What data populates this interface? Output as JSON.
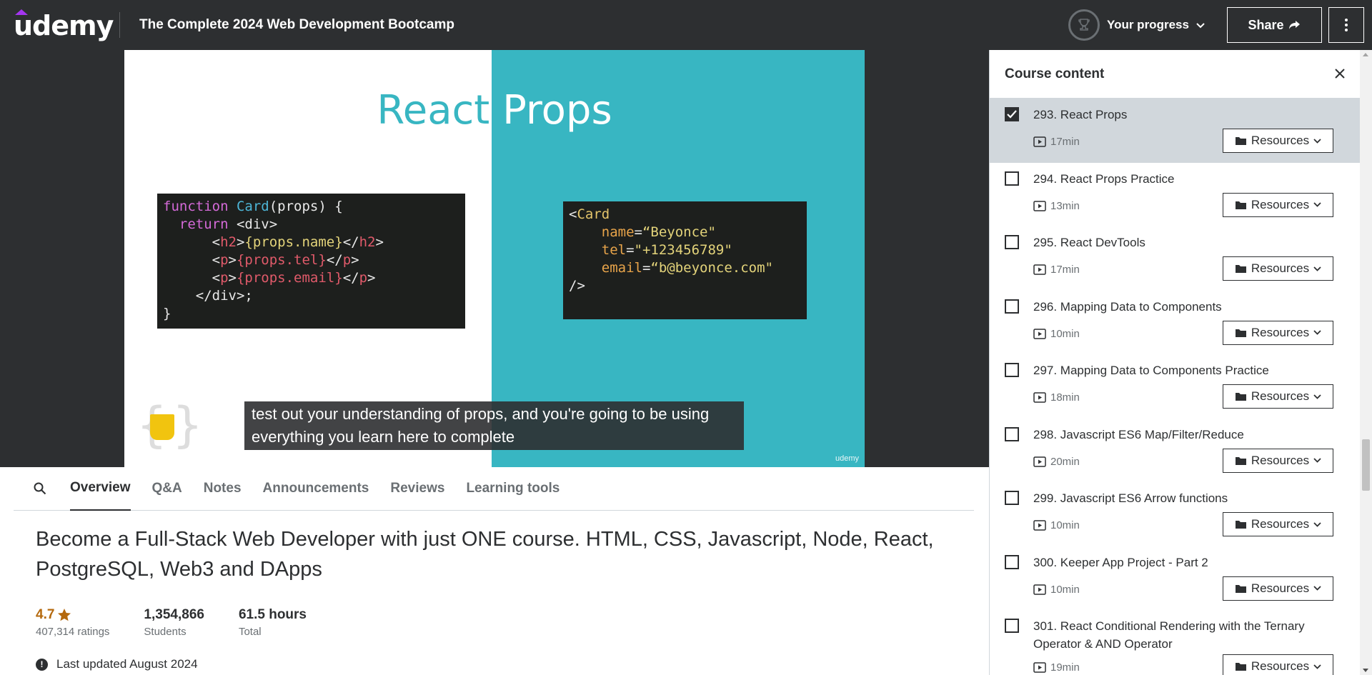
{
  "header": {
    "logo": "udemy",
    "course_title": "The Complete 2024 Web Development Bootcamp",
    "progress_label": "Your progress",
    "share_label": "Share"
  },
  "video": {
    "slide_title_left": "React",
    "slide_title_right": "Props",
    "caption": "test out your understanding of props, and you're going to be using everything you learn here to complete",
    "watermark": "udemy",
    "code_left": {
      "l1a": "function",
      "l1b": "Card",
      "l1c": "(props) {",
      "l2a": "  return ",
      "l2b": "<div>",
      "l3a": "      <",
      "l3b": "h2",
      "l3c": ">",
      "l3d": "{props.name}",
      "l3e": "</",
      "l3f": "h2",
      "l3g": ">",
      "l4a": "      <",
      "l4b": "p",
      "l4c": ">",
      "l4d": "{props.tel}",
      "l4e": "</",
      "l4f": "p",
      "l4g": ">",
      "l5a": "      <",
      "l5b": "p",
      "l5c": ">",
      "l5d": "{props.email}",
      "l5e": "</",
      "l5f": "p",
      "l5g": ">",
      "l6": "    </div>;",
      "l7": "}"
    },
    "code_right": {
      "l1a": "<",
      "l1b": "Card",
      "l2a": "    name",
      "l2b": "=",
      "l2c": "“Beyonce\"",
      "l3a": "    tel",
      "l3b": "=",
      "l3c": "\"+123456789\"",
      "l4a": "    email",
      "l4b": "=",
      "l4c": "“b@beyonce.com\"",
      "l5": "/>"
    }
  },
  "tabs": [
    {
      "label": "Overview"
    },
    {
      "label": "Q&A"
    },
    {
      "label": "Notes"
    },
    {
      "label": "Announcements"
    },
    {
      "label": "Reviews"
    },
    {
      "label": "Learning tools"
    }
  ],
  "overview": {
    "title": "Become a Full-Stack Web Developer with just ONE course. HTML, CSS, Javascript, Node, React, PostgreSQL, Web3 and DApps",
    "rating": "4.7",
    "ratings_count": "407,314 ratings",
    "students": "1,354,866",
    "students_label": "Students",
    "hours": "61.5 hours",
    "hours_label": "Total",
    "updated": "Last updated August 2024"
  },
  "sidebar": {
    "title": "Course content",
    "resources_label": "Resources",
    "lectures": [
      {
        "name": "293. React Props",
        "duration": "17min",
        "checked": true
      },
      {
        "name": "294. React Props Practice",
        "duration": "13min",
        "checked": false
      },
      {
        "name": "295. React DevTools",
        "duration": "17min",
        "checked": false
      },
      {
        "name": "296. Mapping Data to Components",
        "duration": "10min",
        "checked": false
      },
      {
        "name": "297. Mapping Data to Components Practice",
        "duration": "18min",
        "checked": false
      },
      {
        "name": "298. Javascript ES6 Map/Filter/Reduce",
        "duration": "20min",
        "checked": false
      },
      {
        "name": "299. Javascript ES6 Arrow functions",
        "duration": "10min",
        "checked": false
      },
      {
        "name": "300. Keeper App Project - Part 2",
        "duration": "10min",
        "checked": false
      },
      {
        "name": "301. React Conditional Rendering with the Ternary Operator & AND Operator",
        "duration": "19min",
        "checked": false
      }
    ]
  },
  "colors": {
    "header_bg": "#2d2f31",
    "teal": "#38b6c2",
    "brand_purple": "#a435f0",
    "rating": "#b4690e",
    "active_row": "#d1d7dc"
  }
}
